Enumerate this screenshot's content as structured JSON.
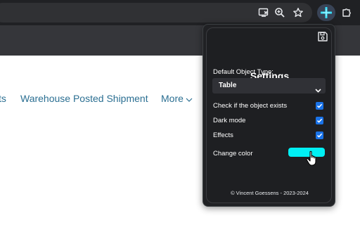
{
  "browser": {
    "toolbar_icons": [
      "install-app-icon",
      "zoom-icon",
      "bookmark-star-icon",
      "extension-active-icon",
      "extensions-puzzle-icon"
    ]
  },
  "page": {
    "nav": {
      "item_partial": "ts",
      "item_warehouse": "Warehouse Posted Shipment",
      "more_label": "More"
    }
  },
  "popup": {
    "title": "Settings",
    "default_object_type_label": "Default Object Type:",
    "default_object_type_value": "Table",
    "options": {
      "check_exists_label": "Check if the object exists",
      "check_exists_checked": true,
      "dark_mode_label": "Dark mode",
      "dark_mode_checked": true,
      "effects_label": "Effects",
      "effects_checked": true
    },
    "change_color_label": "Change color",
    "color_value": "#00f0f4",
    "footer": "© Vincent Goessens - 2023-2024"
  },
  "colors": {
    "accent_blue": "#1a73e8",
    "link_text": "#2b6f92",
    "popup_bg": "#1e1f22"
  }
}
